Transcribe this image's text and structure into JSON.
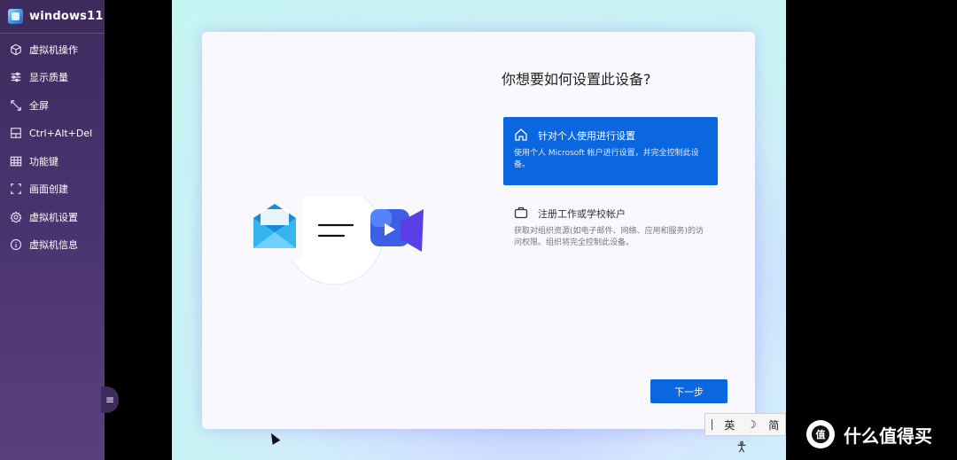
{
  "sidebar": {
    "title": "windows11",
    "items": [
      {
        "label": "虚拟机操作",
        "icon": "cube-icon"
      },
      {
        "label": "显示质量",
        "icon": "sliders-icon"
      },
      {
        "label": "全屏",
        "icon": "expand-icon"
      },
      {
        "label": "Ctrl+Alt+Del",
        "icon": "keyboard-shortcut-icon"
      },
      {
        "label": "功能键",
        "icon": "grid-icon"
      },
      {
        "label": "画面创建",
        "icon": "crop-icon"
      },
      {
        "label": "虚拟机设置",
        "icon": "gear-icon"
      },
      {
        "label": "虚拟机信息",
        "icon": "info-icon"
      }
    ],
    "toggle_icon": "menu-icon",
    "toggle_label": "≡"
  },
  "setup": {
    "question": "你想要如何设置此设备?",
    "personal": {
      "title": "针对个人使用进行设置",
      "desc": "使用个人 Microsoft 帐户进行设置，并完全控制此设备。",
      "icon": "home-icon"
    },
    "work": {
      "title": "注册工作或学校帐户",
      "desc": "获取对组织资源(如电子邮件、网络、应用和服务)的访问权限。组织将完全控制此设备。",
      "icon": "briefcase-icon"
    },
    "next_label": "下一步"
  },
  "ime": {
    "mode": "英",
    "moon": "☽",
    "script": "简"
  },
  "watermark": {
    "text": "什么值得买",
    "logo_glyph": "值"
  },
  "colors": {
    "accent": "#0a67e0",
    "sidebar_bg": "#3e2a5c"
  }
}
